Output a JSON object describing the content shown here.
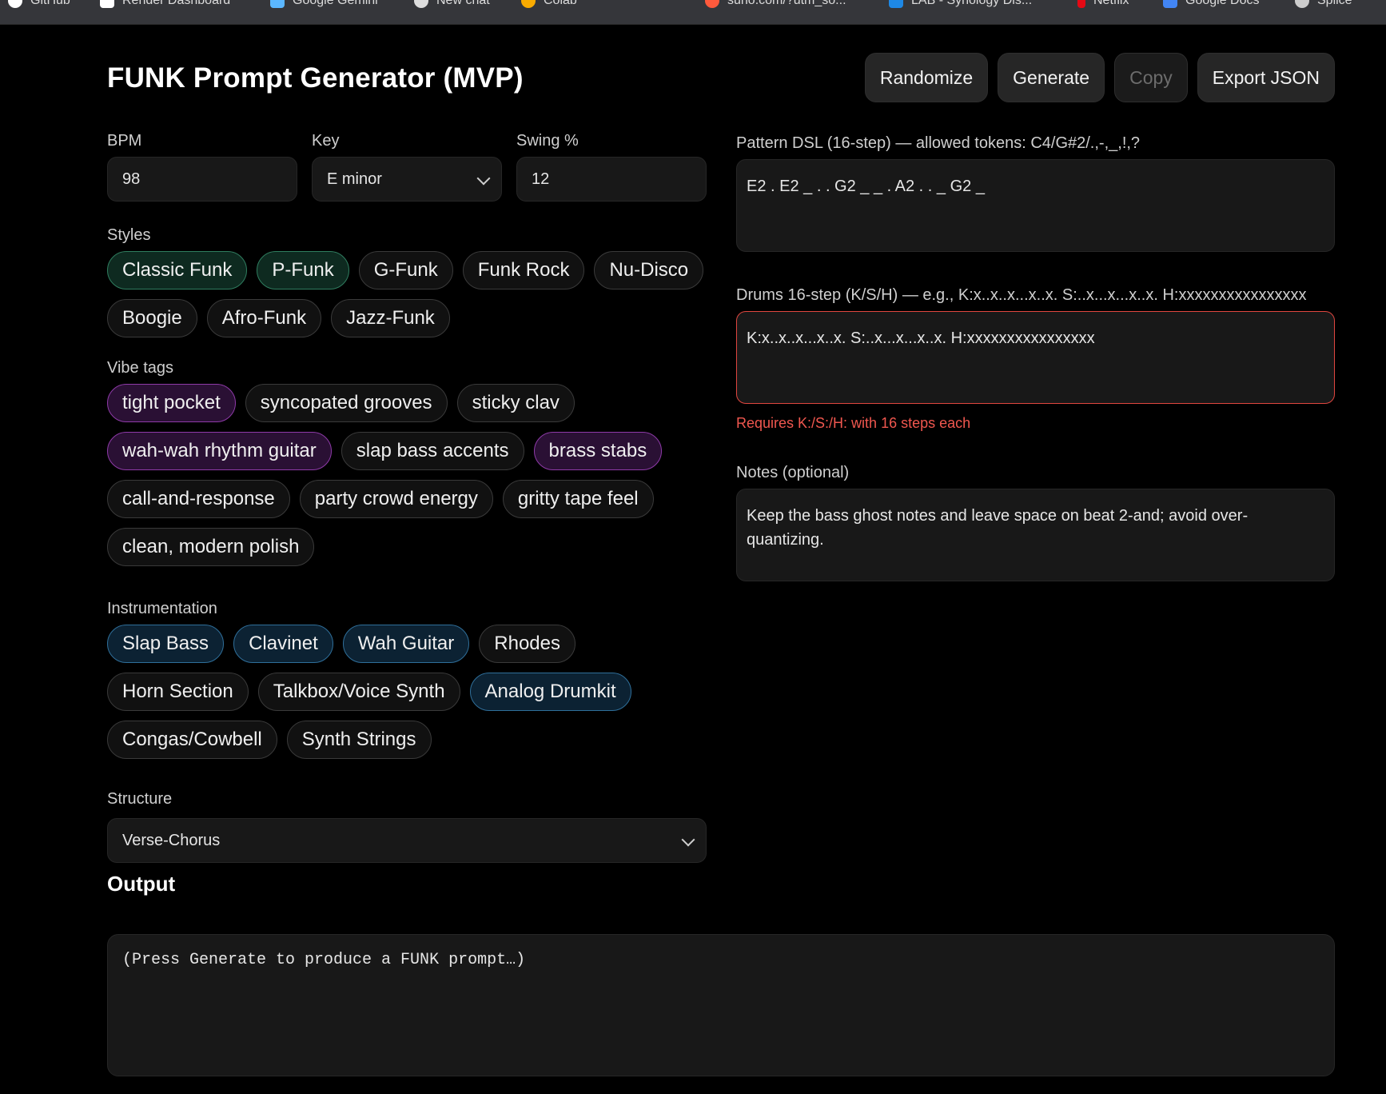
{
  "bookmarks": [
    {
      "label": "GitHub",
      "icon": "github-icon",
      "color": "#ffffff"
    },
    {
      "label": "Render Dashboard",
      "icon": "render-icon",
      "color": "#ffffff"
    },
    {
      "label": "Google Gemini",
      "icon": "gemini-icon",
      "color": "#5bb7ff"
    },
    {
      "label": "New chat",
      "icon": "chatgpt-icon",
      "color": "#ffffff"
    },
    {
      "label": "Colab",
      "icon": "colab-icon",
      "color": "#f9ab00"
    },
    {
      "label": "suno.com/?utm_so...",
      "icon": "suno-icon",
      "color": "#ff5a3c"
    },
    {
      "label": "LAB - Synology Dis...",
      "icon": "synology-icon",
      "color": "#1e88e5"
    },
    {
      "label": "Netflix",
      "icon": "netflix-icon",
      "color": "#e50914"
    },
    {
      "label": "Google Docs",
      "icon": "docs-icon",
      "color": "#4285f4"
    },
    {
      "label": "Splice",
      "icon": "splice-icon",
      "color": "#cccccc"
    }
  ],
  "header": {
    "title": "FUNK Prompt Generator (MVP)",
    "buttons": {
      "randomize": "Randomize",
      "generate": "Generate",
      "copy": "Copy",
      "export": "Export JSON"
    }
  },
  "params": {
    "bpm_label": "BPM",
    "bpm_value": "98",
    "key_label": "Key",
    "key_value": "E minor",
    "swing_label": "Swing %",
    "swing_value": "12"
  },
  "styles": {
    "label": "Styles",
    "items": [
      {
        "label": "Classic Funk",
        "selected": true
      },
      {
        "label": "P-Funk",
        "selected": true
      },
      {
        "label": "G-Funk",
        "selected": false
      },
      {
        "label": "Funk Rock",
        "selected": false
      },
      {
        "label": "Nu-Disco",
        "selected": false
      },
      {
        "label": "Boogie",
        "selected": false
      },
      {
        "label": "Afro-Funk",
        "selected": false
      },
      {
        "label": "Jazz-Funk",
        "selected": false
      }
    ]
  },
  "vibes": {
    "label": "Vibe tags",
    "items": [
      {
        "label": "tight pocket",
        "selected": true
      },
      {
        "label": "syncopated grooves",
        "selected": false
      },
      {
        "label": "sticky clav",
        "selected": false
      },
      {
        "label": "wah-wah rhythm guitar",
        "selected": true
      },
      {
        "label": "slap bass accents",
        "selected": false
      },
      {
        "label": "brass stabs",
        "selected": true
      },
      {
        "label": "call-and-response",
        "selected": false
      },
      {
        "label": "party crowd energy",
        "selected": false
      },
      {
        "label": "gritty tape feel",
        "selected": false
      },
      {
        "label": "clean, modern polish",
        "selected": false
      }
    ]
  },
  "instrumentation": {
    "label": "Instrumentation",
    "items": [
      {
        "label": "Slap Bass",
        "selected": true
      },
      {
        "label": "Clavinet",
        "selected": true
      },
      {
        "label": "Wah Guitar",
        "selected": true
      },
      {
        "label": "Rhodes",
        "selected": false
      },
      {
        "label": "Horn Section",
        "selected": false
      },
      {
        "label": "Talkbox/Voice Synth",
        "selected": false
      },
      {
        "label": "Analog Drumkit",
        "selected": true
      },
      {
        "label": "Congas/Cowbell",
        "selected": false
      },
      {
        "label": "Synth Strings",
        "selected": false
      }
    ]
  },
  "structure": {
    "label": "Structure",
    "value": "Verse-Chorus"
  },
  "pattern": {
    "label": "Pattern DSL (16-step) — allowed tokens: C4/G#2/.,-,_,!,?",
    "value": "E2 . E2 _ . . G2 _ _ . A2 . . _ G2 _"
  },
  "drums": {
    "label": "Drums 16-step (K/S/H) — e.g., K:x..x..x...x..x. S:..x...x...x..x. H:xxxxxxxxxxxxxxxx",
    "value": "K:x..x..x...x..x. S:..x...x...x..x. H:xxxxxxxxxxxxxxxx",
    "error": "Requires K:/S:/H: with 16 steps each"
  },
  "notes": {
    "label": "Notes (optional)",
    "value": "Keep the bass ghost notes and leave space on beat 2-and; avoid over-quantizing."
  },
  "output": {
    "heading": "Output",
    "text": "(Press Generate to produce a FUNK prompt…)"
  },
  "colors": {
    "error": "#f0574f",
    "chip_green": "#2f7d5f",
    "chip_purple": "#8e3aa8",
    "chip_blue": "#2f6f9a"
  }
}
